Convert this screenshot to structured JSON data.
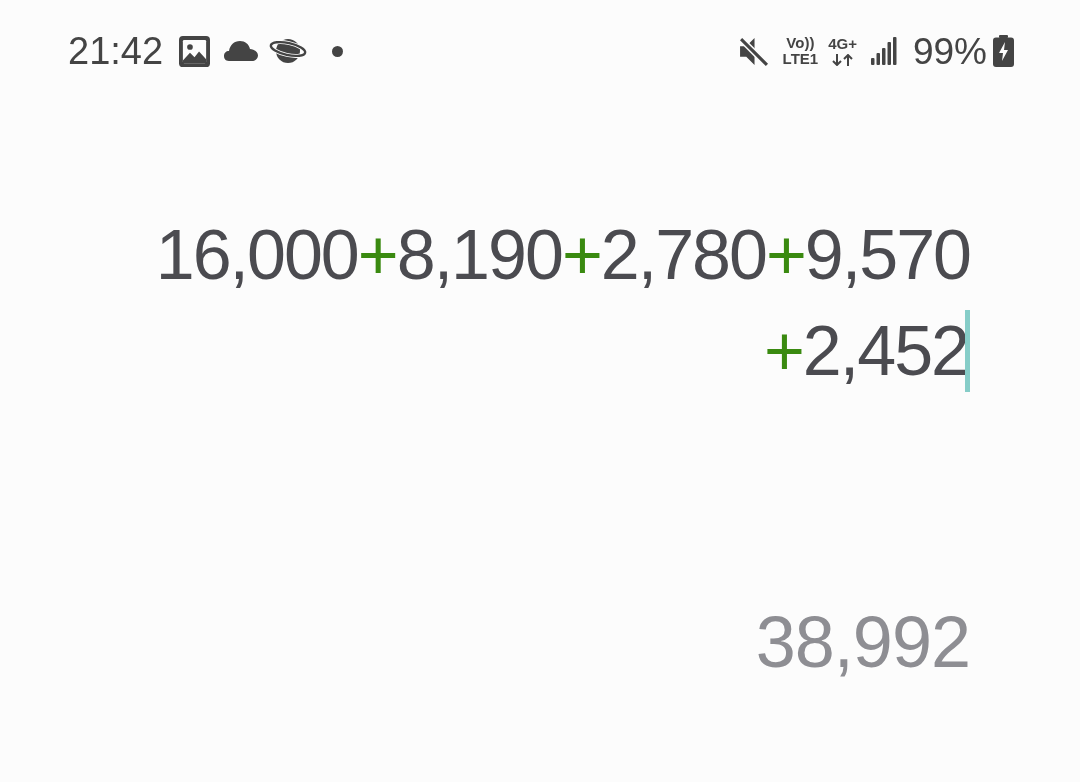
{
  "status_bar": {
    "time": "21:42",
    "notifications": [
      {
        "kind": "image"
      },
      {
        "kind": "cloud"
      },
      {
        "kind": "planet"
      },
      {
        "kind": "dot"
      }
    ],
    "volte_top": "Vo))",
    "volte_bottom": "LTE1",
    "data_type": "4G+",
    "battery_percent": "99%"
  },
  "expression": {
    "focused": true,
    "lines": [
      [
        {
          "kind": "number",
          "text": "16,000"
        },
        {
          "kind": "operator",
          "text": "+"
        },
        {
          "kind": "number",
          "text": "8,190"
        },
        {
          "kind": "operator",
          "text": "+"
        },
        {
          "kind": "number",
          "text": "2,780"
        },
        {
          "kind": "operator",
          "text": "+"
        },
        {
          "kind": "number",
          "text": "9,570"
        }
      ],
      [
        {
          "kind": "operator",
          "text": "+"
        },
        {
          "kind": "number",
          "text": "2,452"
        }
      ]
    ]
  },
  "result": "38,992"
}
